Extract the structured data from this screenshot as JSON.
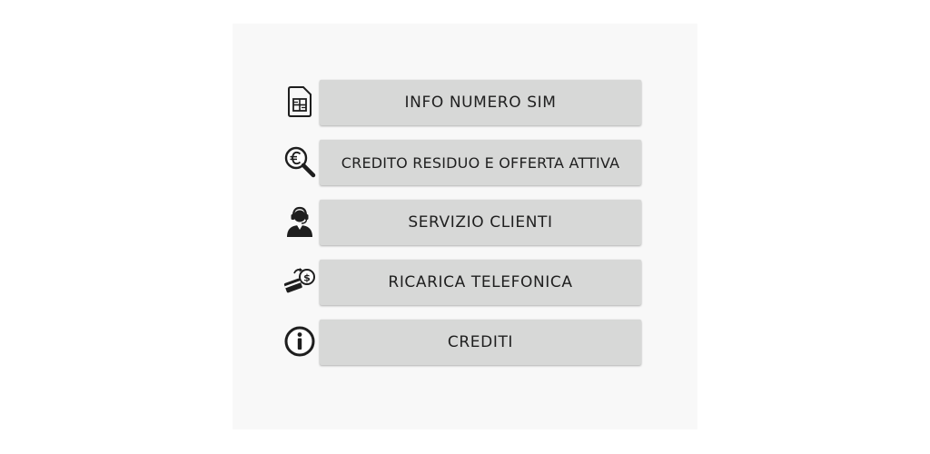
{
  "menu": {
    "items": [
      {
        "id": "info-sim",
        "label": "INFO NUMERO SIM",
        "icon": "sim-card-icon"
      },
      {
        "id": "credito",
        "label": "CREDITO RESIDUO E OFFERTA ATTIVA",
        "icon": "euro-search-icon"
      },
      {
        "id": "servizio",
        "label": "SERVIZIO CLIENTI",
        "icon": "customer-support-icon"
      },
      {
        "id": "ricarica",
        "label": "RICARICA TELEFONICA",
        "icon": "card-payment-icon"
      },
      {
        "id": "crediti",
        "label": "CREDITI",
        "icon": "info-icon"
      }
    ]
  },
  "colors": {
    "page_background": "#ffffff",
    "panel_background": "#f8f8f8",
    "button_background": "#d7d8d7",
    "button_text": "#1f1f1f",
    "icon": "#1e1e1e"
  }
}
